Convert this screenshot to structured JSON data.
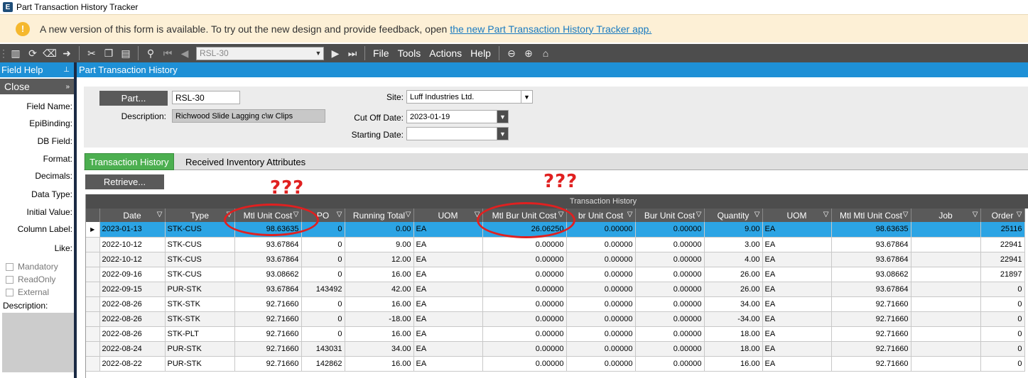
{
  "window": {
    "title": "Part Transaction History Tracker",
    "icon": "E"
  },
  "banner": {
    "message": "A new version of this form is available. To try out the new design and provide feedback, open",
    "link_text": "the new Part Transaction History Tracker app."
  },
  "toolbar": {
    "part_combo_value": "RSL-30",
    "menus": [
      "File",
      "Tools",
      "Actions",
      "Help"
    ]
  },
  "sidebar": {
    "header": "Field Help",
    "close_label": "Close",
    "labels": [
      "Field Name:",
      "EpiBinding:",
      "DB Field:",
      "Format:",
      "Decimals:",
      "Data Type:",
      "Initial Value:",
      "Column Label:",
      "Like:"
    ],
    "checkboxes": [
      "Mandatory",
      "ReadOnly",
      "External"
    ],
    "description_label": "Description:"
  },
  "form": {
    "header": "Part Transaction History",
    "part_button": "Part...",
    "part_value": "RSL-30",
    "description_label": "Description:",
    "description_value": "Richwood Slide Lagging c\\w Clips",
    "site_label": "Site:",
    "site_value": "Luff Industries Ltd.",
    "cutoff_label": "Cut Off Date:",
    "cutoff_value": "2023-01-19",
    "starting_label": "Starting Date:",
    "starting_value": ""
  },
  "tabs": [
    {
      "label": "Transaction History",
      "active": true
    },
    {
      "label": "Received Inventory Attributes",
      "active": false
    }
  ],
  "retrieve_label": "Retrieve...",
  "grid": {
    "group_title": "Transaction History",
    "columns": [
      "Date",
      "Type",
      "Mtl Unit Cost",
      "PO",
      "Running Total",
      "UOM",
      "Mtl Bur Unit Cost",
      "br Unit Cost",
      "Bur Unit Cost",
      "Quantity",
      "UOM",
      "Mtl Mtl Unit Cost",
      "Job",
      "Order"
    ],
    "rows": [
      [
        "2023-01-13",
        "STK-CUS",
        "98.63635",
        "0",
        "0.00",
        "EA",
        "26.06250",
        "0.00000",
        "0.00000",
        "9.00",
        "EA",
        "98.63635",
        "",
        "25116"
      ],
      [
        "2022-10-12",
        "STK-CUS",
        "93.67864",
        "0",
        "9.00",
        "EA",
        "0.00000",
        "0.00000",
        "0.00000",
        "3.00",
        "EA",
        "93.67864",
        "",
        "22941"
      ],
      [
        "2022-10-12",
        "STK-CUS",
        "93.67864",
        "0",
        "12.00",
        "EA",
        "0.00000",
        "0.00000",
        "0.00000",
        "4.00",
        "EA",
        "93.67864",
        "",
        "22941"
      ],
      [
        "2022-09-16",
        "STK-CUS",
        "93.08662",
        "0",
        "16.00",
        "EA",
        "0.00000",
        "0.00000",
        "0.00000",
        "26.00",
        "EA",
        "93.08662",
        "",
        "21897"
      ],
      [
        "2022-09-15",
        "PUR-STK",
        "93.67864",
        "143492",
        "42.00",
        "EA",
        "0.00000",
        "0.00000",
        "0.00000",
        "26.00",
        "EA",
        "93.67864",
        "",
        "0"
      ],
      [
        "2022-08-26",
        "STK-STK",
        "92.71660",
        "0",
        "16.00",
        "EA",
        "0.00000",
        "0.00000",
        "0.00000",
        "34.00",
        "EA",
        "92.71660",
        "",
        "0"
      ],
      [
        "2022-08-26",
        "STK-STK",
        "92.71660",
        "0",
        "-18.00",
        "EA",
        "0.00000",
        "0.00000",
        "0.00000",
        "-34.00",
        "EA",
        "92.71660",
        "",
        "0"
      ],
      [
        "2022-08-26",
        "STK-PLT",
        "92.71660",
        "0",
        "16.00",
        "EA",
        "0.00000",
        "0.00000",
        "0.00000",
        "18.00",
        "EA",
        "92.71660",
        "",
        "0"
      ],
      [
        "2022-08-24",
        "PUR-STK",
        "92.71660",
        "143031",
        "34.00",
        "EA",
        "0.00000",
        "0.00000",
        "0.00000",
        "18.00",
        "EA",
        "92.71660",
        "",
        "0"
      ],
      [
        "2022-08-22",
        "PUR-STK",
        "92.71660",
        "142862",
        "16.00",
        "EA",
        "0.00000",
        "0.00000",
        "0.00000",
        "16.00",
        "EA",
        "92.71660",
        "",
        "0"
      ]
    ],
    "selected_row": 0
  },
  "annotations": {
    "mark1": "???",
    "mark2": "???",
    "color": "#e02020"
  }
}
